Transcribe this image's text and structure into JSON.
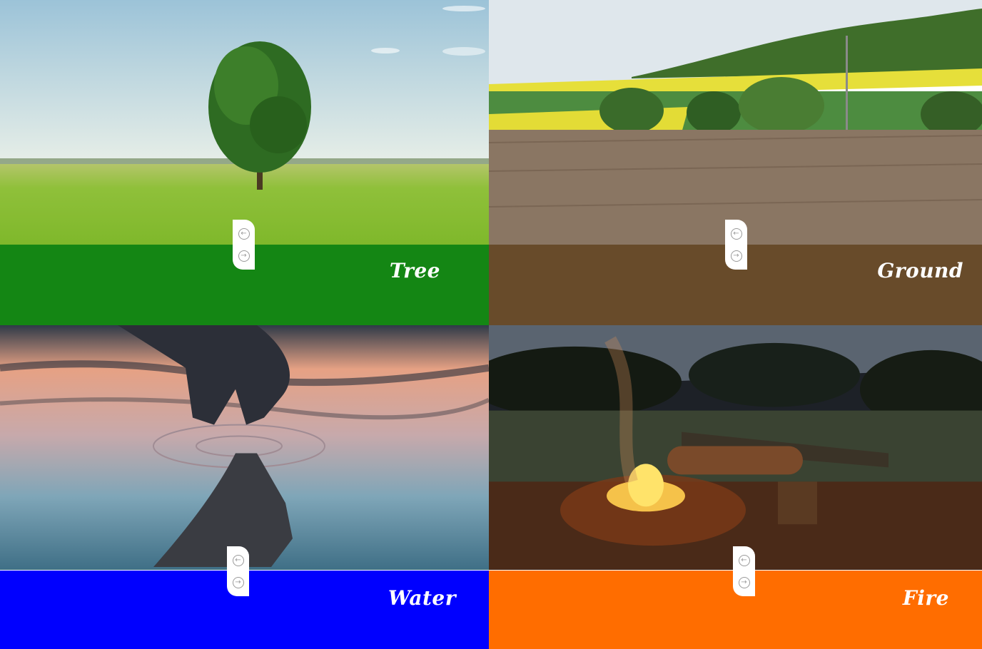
{
  "cards": [
    {
      "label": "Tree",
      "band_color": "#148614",
      "prev_icon": "arrow-left-circle-icon",
      "next_icon": "arrow-right-circle-icon"
    },
    {
      "label": "Ground",
      "band_color": "#684b2a",
      "prev_icon": "arrow-left-circle-icon",
      "next_icon": "arrow-right-circle-icon"
    },
    {
      "label": "Water",
      "band_color": "#0000ff",
      "prev_icon": "arrow-left-circle-icon",
      "next_icon": "arrow-right-circle-icon"
    },
    {
      "label": "Fire",
      "band_color": "#ff6d00",
      "prev_icon": "arrow-left-circle-icon",
      "next_icon": "arrow-right-circle-icon"
    }
  ],
  "nav": {
    "prev_glyph": "←",
    "next_glyph": "→"
  }
}
